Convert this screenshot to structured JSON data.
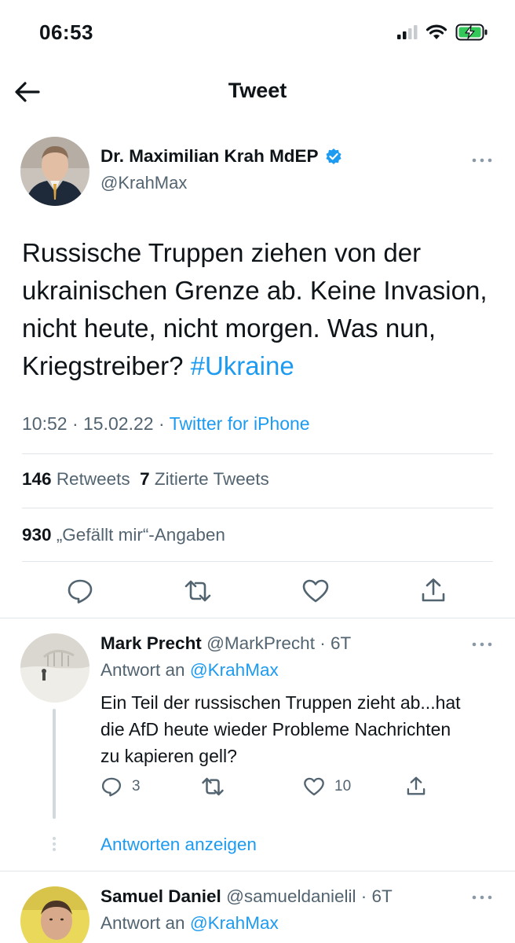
{
  "status_bar": {
    "time": "06:53",
    "icons": [
      "signal-icon",
      "wifi-icon",
      "battery-charging-icon"
    ]
  },
  "header": {
    "title": "Tweet",
    "back_icon": "arrow-left-icon"
  },
  "tweet": {
    "author_name": "Dr. Maximilian Krah MdEP",
    "verified_icon": "verified-badge-icon",
    "handle": "@KrahMax",
    "text": "Russische Truppen ziehen von der ukrainischen Grenze ab. Keine Invasion, nicht heute, nicht morgen. Was nun, Kriegstreiber?",
    "hashtag": "#Ukraine",
    "time": "10:52",
    "date": "15.02.22",
    "separator": "·",
    "source": "Twitter for iPhone",
    "retweets_count": "146",
    "retweets_label": "Retweets",
    "quotes_count": "7",
    "quotes_label": "Zitierte Tweets",
    "likes_count": "930",
    "likes_label": "„Gefällt mir“-Angaben",
    "actions": [
      "reply-icon",
      "retweet-icon",
      "like-icon",
      "share-icon"
    ]
  },
  "replies": [
    {
      "name": "Mark Precht",
      "handle": "@MarkPrecht",
      "age": "· 6T",
      "reply_to_label": "Antwort an",
      "reply_to_handle": "@KrahMax",
      "text": "Ein Teil der russischen Truppen zieht ab...hat die AfD heute wieder Probleme Nachrichten zu kapieren gell?",
      "reply_count": "3",
      "retweet_count": "",
      "like_count": "10",
      "show_replies": "Antworten anzeigen"
    },
    {
      "name": "Samuel Daniel",
      "handle": "@samueldanielil",
      "age": "· 6T",
      "reply_to_label": "Antwort an",
      "reply_to_handle": "@KrahMax"
    }
  ],
  "colors": {
    "accent": "#1d9bf0",
    "text": "#0f1419",
    "muted": "#536471",
    "divider": "#e1e6ea",
    "battery": "#34c759"
  }
}
